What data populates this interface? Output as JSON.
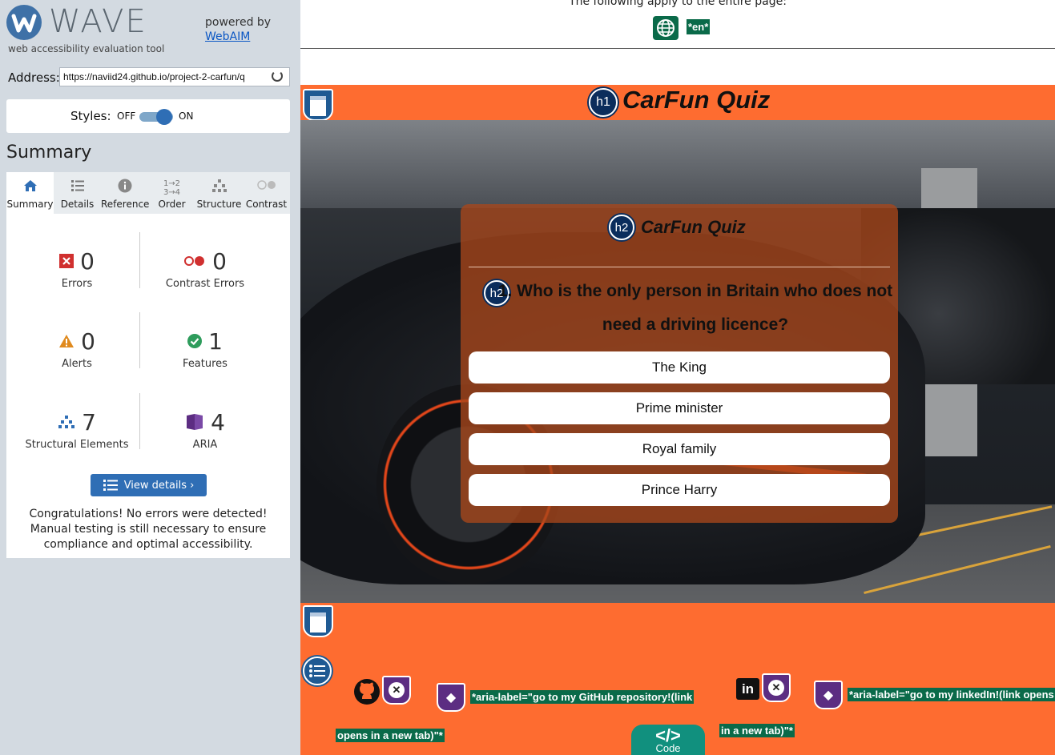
{
  "wave": {
    "logo_word": "WAVE",
    "subtitle": "web accessibility evaluation tool",
    "powered_by": "powered by",
    "webaim_link": "WebAIM",
    "address_label": "Address:",
    "address_value": "https://naviid24.github.io/project-2-carfun/q",
    "styles_label": "Styles:",
    "styles_off": "OFF",
    "styles_on": "ON",
    "styles_enabled": true,
    "summary_heading": "Summary",
    "tabs": [
      {
        "label": "Summary",
        "icon": "home-icon",
        "active": true
      },
      {
        "label": "Details",
        "icon": "list-icon"
      },
      {
        "label": "Reference",
        "icon": "info-icon"
      },
      {
        "label": "Order",
        "icon": "order-icon"
      },
      {
        "label": "Structure",
        "icon": "hierarchy-icon"
      },
      {
        "label": "Contrast",
        "icon": "contrast-icon"
      }
    ],
    "stats": {
      "errors": {
        "count": "0",
        "label": "Errors",
        "color": "#d0302f"
      },
      "contrast_errors": {
        "count": "0",
        "label": "Contrast Errors",
        "color": "#d0302f"
      },
      "alerts": {
        "count": "0",
        "label": "Alerts",
        "color": "#e08a1e"
      },
      "features": {
        "count": "1",
        "label": "Features",
        "color": "#2e9c5c"
      },
      "structural": {
        "count": "7",
        "label": "Structural Elements",
        "color": "#2f6eb5"
      },
      "aria": {
        "count": "4",
        "label": "ARIA",
        "color": "#5c2d82"
      }
    },
    "view_details": "View details ›",
    "congrats": "Congratulations! No errors were detected! Manual testing is still necessary to ensure compliance and optimal accessibility."
  },
  "page": {
    "top_note": "The following apply to the entire page:",
    "lang_badge": "*en*",
    "h1_badge": "h1",
    "main_title": "CarFun Quiz",
    "quiz": {
      "h2_badge": "h2",
      "title": "CarFun Quiz",
      "question": "1. Who is the only person in Britain who does not need a driving licence?",
      "answers": [
        "The King",
        "Prime minister",
        "Royal family",
        "Prince Harry"
      ]
    },
    "footer": {
      "github_aria_1": "*aria-label=\"go to my GitHub repository!(link",
      "github_aria_2": "opens in a new tab)\"*",
      "linkedin_aria_1": "*aria-label=\"go to my linkedIn!(link opens",
      "linkedin_aria_2": "in a new tab)\"*",
      "linkedin_glyph": "in",
      "code_glyph": "</>",
      "code_label": "Code"
    },
    "colors": {
      "brand_orange": "#fe6c30",
      "wave_green": "#0a6a49",
      "aria_purple": "#5c2d82"
    }
  }
}
